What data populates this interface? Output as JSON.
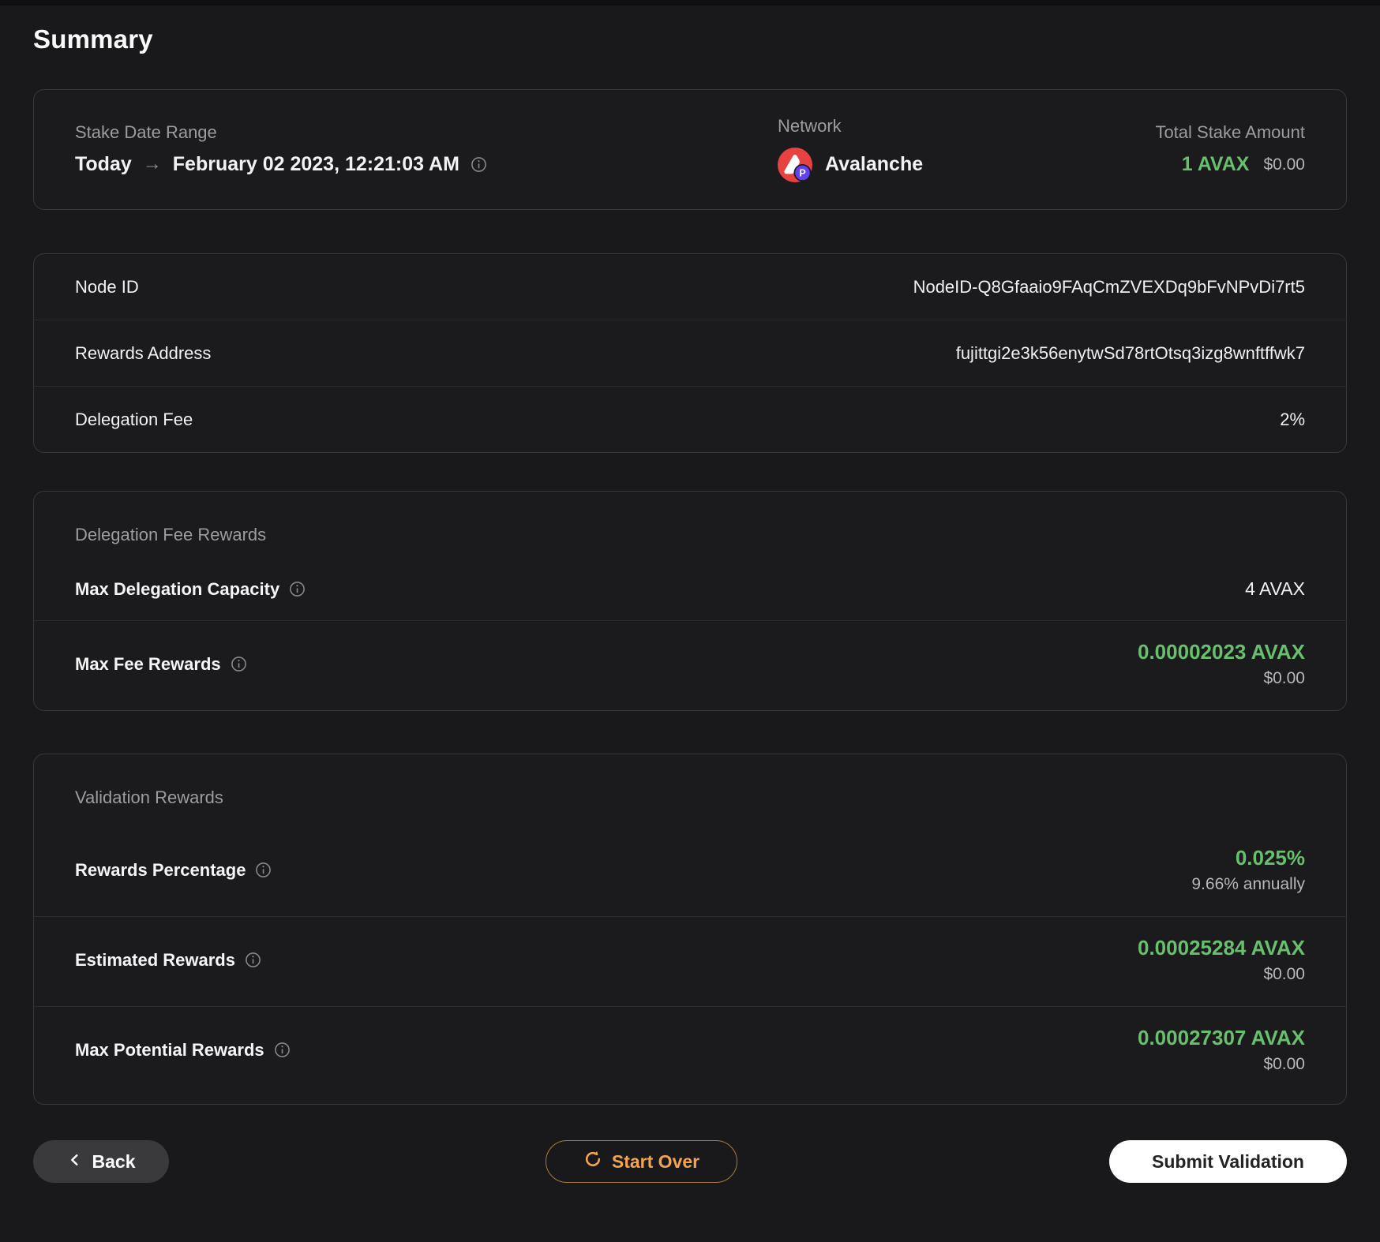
{
  "page": {
    "title": "Summary"
  },
  "colors": {
    "positive_green": "#68bf6d",
    "warning_orange": "#f2a44f"
  },
  "icons": {
    "network": "avalanche-p-chain-icon",
    "info": "info-icon",
    "back": "chevron-left-icon",
    "start_over": "refresh-icon",
    "range_arrow": "arrow-right-icon"
  },
  "overview": {
    "stake_date_range": {
      "label": "Stake Date Range",
      "from": "Today",
      "arrow": "→",
      "to": "February 02 2023, 12:21:03 AM"
    },
    "network": {
      "label": "Network",
      "value": "Avalanche",
      "badge": "P"
    },
    "total_stake": {
      "label": "Total Stake Amount",
      "amount": "1 AVAX",
      "usd": "$0.00"
    }
  },
  "details": {
    "rows": [
      {
        "label": "Node ID",
        "value": "NodeID-Q8Gfaaio9FAqCmZVEXDq9bFvNPvDi7rt5"
      },
      {
        "label": "Rewards Address",
        "value": "fujittgi2e3k56enytwSd78rtOtsq3izg8wnftffwk7"
      },
      {
        "label": "Delegation Fee",
        "value": "2%"
      }
    ]
  },
  "fee_rewards": {
    "title": "Delegation Fee Rewards",
    "rows": [
      {
        "label": "Max Delegation Capacity",
        "value": "4 AVAX"
      },
      {
        "label": "Max Fee Rewards",
        "value": "0.00002023 AVAX",
        "usd": "$0.00"
      }
    ]
  },
  "validation_rewards": {
    "title": "Validation Rewards",
    "rows": [
      {
        "label": "Rewards Percentage",
        "value": "0.025%",
        "sub": "9.66% annually"
      },
      {
        "label": "Estimated Rewards",
        "value": "0.00025284 AVAX",
        "sub": "$0.00"
      },
      {
        "label": "Max Potential Rewards",
        "value": "0.00027307 AVAX",
        "sub": "$0.00"
      }
    ]
  },
  "footer": {
    "back_label": "Back",
    "start_over_label": "Start Over",
    "submit_label": "Submit Validation"
  }
}
